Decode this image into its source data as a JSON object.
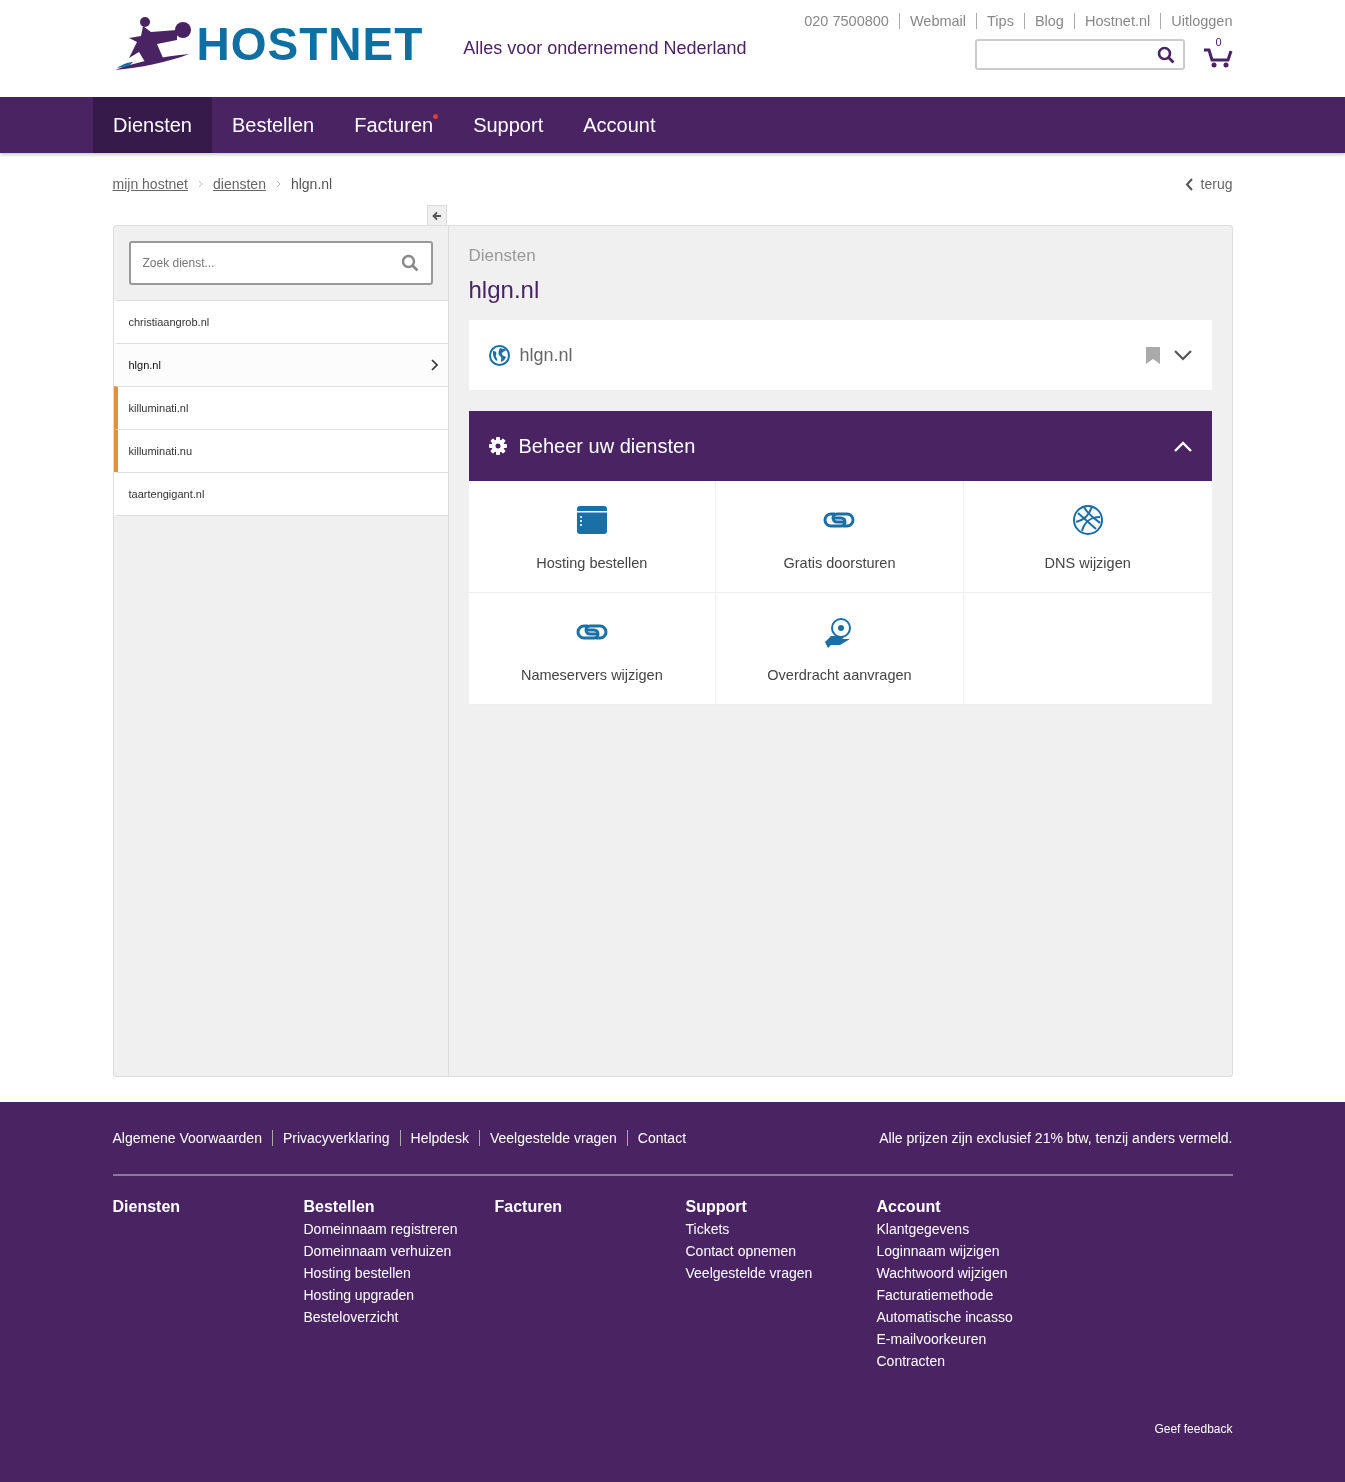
{
  "header": {
    "logo": "HOSTNET",
    "tagline": "Alles voor ondernemend Nederland",
    "top_links": [
      "020 7500800",
      "Webmail",
      "Tips",
      "Blog",
      "Hostnet.nl",
      "Uitloggen"
    ],
    "cart_count": "0"
  },
  "nav": [
    {
      "label": "Diensten",
      "selected": true,
      "badge": false
    },
    {
      "label": "Bestellen",
      "selected": false,
      "badge": false
    },
    {
      "label": "Facturen",
      "selected": false,
      "badge": true
    },
    {
      "label": "Support",
      "selected": false,
      "badge": false
    },
    {
      "label": "Account",
      "selected": false,
      "badge": false
    }
  ],
  "breadcrumb": [
    "mijn hostnet",
    "diensten",
    "hlgn.nl"
  ],
  "back_link": "terug",
  "sidebar": {
    "search": {
      "placeholder": "Zoek dienst..."
    },
    "items": [
      {
        "label": "christiaangrob.nl",
        "selected": false,
        "flagged": false
      },
      {
        "label": "hlgn.nl",
        "selected": true,
        "flagged": false
      },
      {
        "label": "killuminati.nl",
        "selected": false,
        "flagged": true
      },
      {
        "label": "killuminati.nu",
        "selected": false,
        "flagged": true
      },
      {
        "label": "taartengigant.nl",
        "selected": false,
        "flagged": false
      }
    ]
  },
  "main": {
    "section": "Diensten",
    "title": "hlgn.nl",
    "domain_card": {
      "name": "hlgn.nl",
      "expanded": false
    },
    "manage": {
      "title": "Beheer uw diensten",
      "expanded": true,
      "actions": [
        {
          "label": "Hosting bestellen",
          "kind": "hosting"
        },
        {
          "label": "Gratis doorsturen",
          "kind": "link"
        },
        {
          "label": "DNS wijzigen",
          "kind": "dns"
        },
        {
          "label": "Nameservers wijzigen",
          "kind": "link"
        },
        {
          "label": "Overdracht aanvragen",
          "kind": "transfer"
        }
      ]
    }
  },
  "footer": {
    "links": [
      "Algemene Voorwaarden",
      "Privacyverklaring",
      "Helpdesk",
      "Veelgestelde vragen",
      "Contact"
    ],
    "note": "Alle prijzen zijn exclusief 21% btw, tenzij anders vermeld.",
    "columns": [
      {
        "title": "Diensten"
      },
      {
        "title": "Bestellen",
        "links": [
          "Domeinnaam registreren",
          "Domeinnaam verhuizen",
          "Hosting bestellen",
          "Hosting upgraden",
          "Besteloverzicht"
        ]
      },
      {
        "title": "Facturen"
      },
      {
        "title": "Support",
        "links": [
          "Tickets",
          "Contact opnemen",
          "Veelgestelde vragen"
        ]
      },
      {
        "title": "Account",
        "links": [
          "Klantgegevens",
          "Loginnaam wijzigen",
          "Wachtwoord wijzigen",
          "Facturatiemethode",
          "Automatische incasso",
          "E-mailvoorkeuren",
          "Contracten"
        ]
      }
    ],
    "feedback": "Geef feedback"
  }
}
